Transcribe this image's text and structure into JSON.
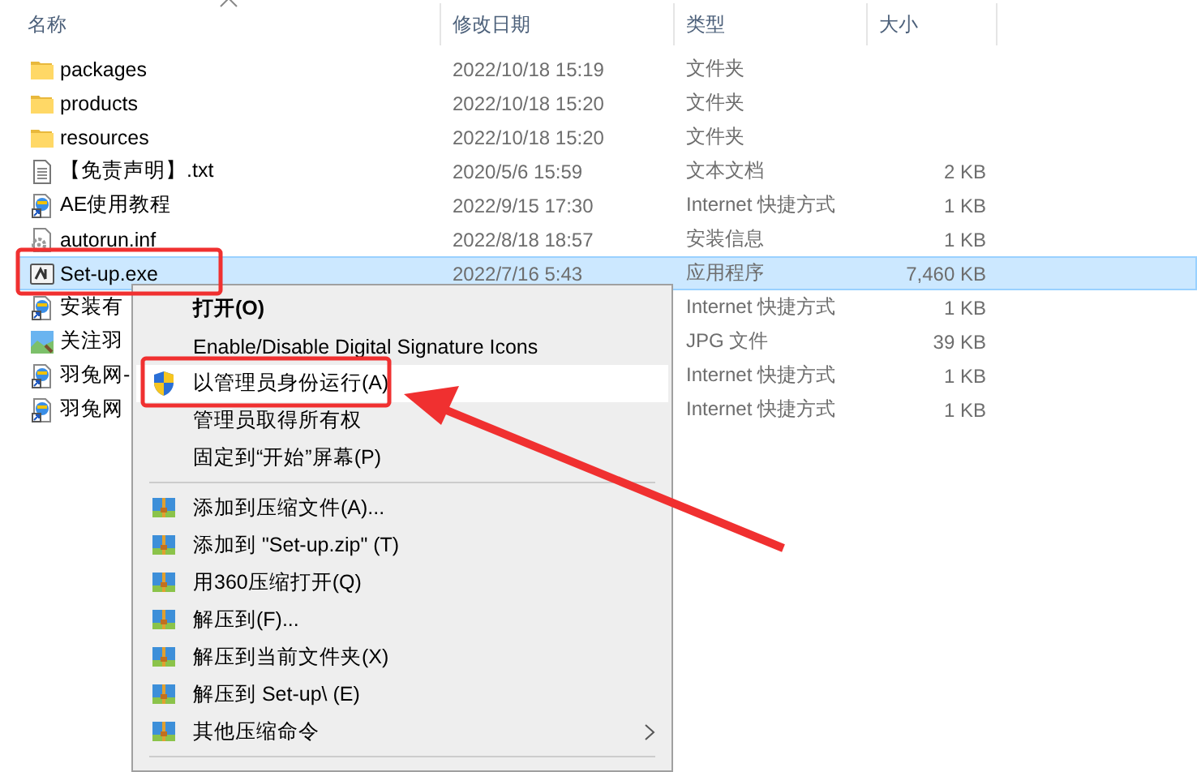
{
  "columns": [
    {
      "label": "名称",
      "sorted": true
    },
    {
      "label": "修改日期",
      "sorted": false
    },
    {
      "label": "类型",
      "sorted": false
    },
    {
      "label": "大小",
      "sorted": false
    }
  ],
  "rows": [
    {
      "kind": "folder",
      "name": "packages",
      "date": "2022/10/18 15:19",
      "type": "文件夹",
      "selected": false
    },
    {
      "kind": "folder",
      "name": "products",
      "date": "2022/10/18 15:20",
      "type": "文件夹",
      "selected": false
    },
    {
      "kind": "folder",
      "name": "resources",
      "date": "2022/10/18 15:20",
      "type": "文件夹",
      "selected": false
    },
    {
      "kind": "text",
      "name": "【免责声明】.txt",
      "date": "2020/5/6 15:59",
      "type": "文本文档",
      "size": "2 KB",
      "selected": false
    },
    {
      "kind": "shortcut",
      "name": "AE使用教程",
      "date": "2022/9/15 17:30",
      "type": "Internet 快捷方式",
      "size": "1 KB",
      "selected": false
    },
    {
      "kind": "setup-info",
      "name": "autorun.inf",
      "date": "2022/8/18 18:57",
      "type": "安装信息",
      "size": "1 KB",
      "selected": false
    },
    {
      "kind": "application",
      "name": "Set-up.exe",
      "date": "2022/7/16 5:43",
      "type": "应用程序",
      "size": "7,460 KB",
      "selected": true
    },
    {
      "kind": "shortcut",
      "name": "安装有",
      "type": "Internet 快捷方式",
      "size": "1 KB",
      "selected": false
    },
    {
      "kind": "image",
      "name": "关注羽",
      "type": "JPG 文件",
      "size": "39 KB",
      "selected": false
    },
    {
      "kind": "shortcut",
      "name": "羽兔网-",
      "type": "Internet 快捷方式",
      "size": "1 KB",
      "selected": false
    },
    {
      "kind": "shortcut",
      "name": "羽兔网",
      "type": "Internet 快捷方式",
      "size": "1 KB",
      "selected": false
    }
  ],
  "menu": {
    "items": [
      {
        "kind": "plain",
        "label": "打开(O)",
        "default": true,
        "selected": false
      },
      {
        "kind": "plain",
        "label": "Enable/Disable Digital Signature Icons",
        "default": false,
        "selected": false
      },
      {
        "kind": "shield",
        "label": "以管理员身份运行(A)",
        "default": false,
        "selected": true
      },
      {
        "kind": "plain",
        "label": "管理员取得所有权",
        "default": false,
        "selected": false
      },
      {
        "kind": "plain",
        "label": "固定到“开始”屏幕(P)",
        "default": false,
        "selected": false
      },
      {
        "kind": "separator"
      },
      {
        "kind": "archive",
        "label": "添加到压缩文件(A)...",
        "default": false,
        "selected": false
      },
      {
        "kind": "archive",
        "label": "添加到 \"Set-up.zip\" (T)",
        "default": false,
        "selected": false
      },
      {
        "kind": "archive",
        "label": "用360压缩打开(Q)",
        "default": false,
        "selected": false
      },
      {
        "kind": "archive",
        "label": "解压到(F)...",
        "default": false,
        "selected": false
      },
      {
        "kind": "archive",
        "label": "解压到当前文件夹(X)",
        "default": false,
        "selected": false
      },
      {
        "kind": "archive",
        "label": "解压到 Set-up\\ (E)",
        "default": false,
        "selected": false
      },
      {
        "kind": "archive",
        "label": "其他压缩命令",
        "default": false,
        "selected": false,
        "submenu": true
      },
      {
        "kind": "separator"
      }
    ]
  }
}
